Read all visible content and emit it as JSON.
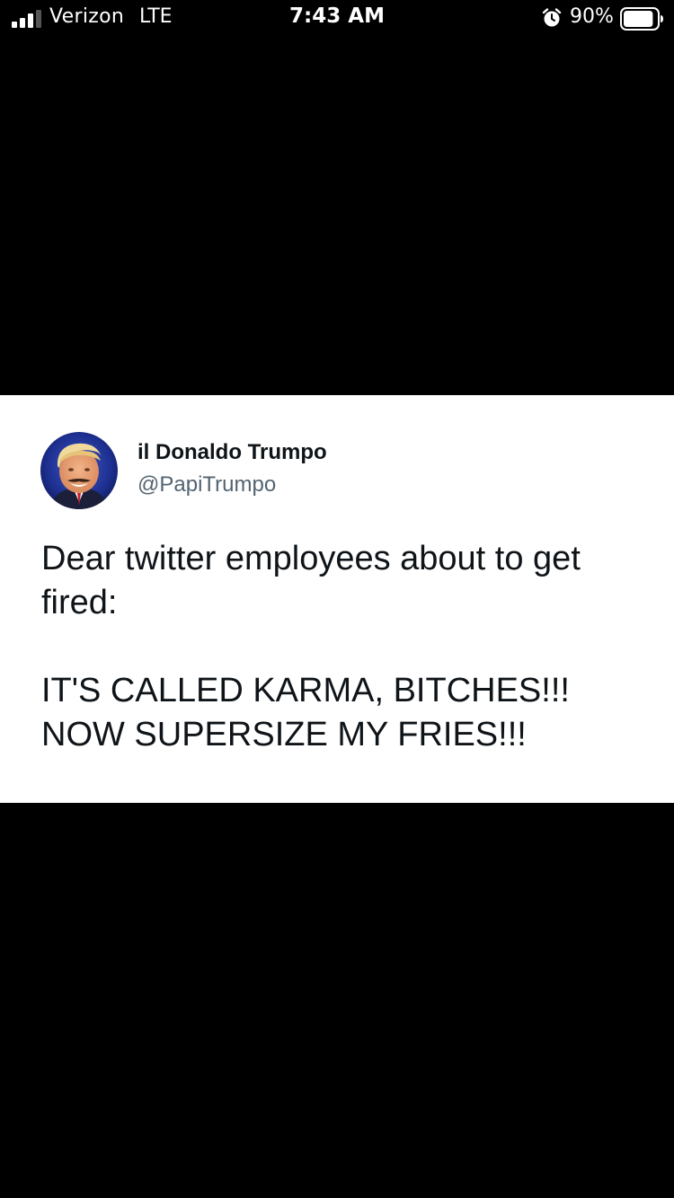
{
  "status_bar": {
    "carrier": "Verizon",
    "network": "LTE",
    "time": "7:43 AM",
    "battery_percent": "90%",
    "signal_bars": 3,
    "signal_bars_total": 4,
    "battery_level": 0.9
  },
  "tweet": {
    "display_name": "il Donaldo Trumpo",
    "handle": "@PapiTrumpo",
    "lines": [
      "Dear twitter employees about to get",
      "fired:",
      "IT'S CALLED KARMA, BITCHES!!!",
      "NOW SUPERSIZE MY FRIES!!!"
    ]
  },
  "colors": {
    "background": "#000000",
    "card": "#ffffff",
    "text_primary": "#0f1419",
    "text_secondary": "#536471",
    "status_text": "#ffffff"
  },
  "icons": {
    "signal": "cellular-signal-icon",
    "alarm": "alarm-clock-icon",
    "battery": "battery-icon"
  }
}
